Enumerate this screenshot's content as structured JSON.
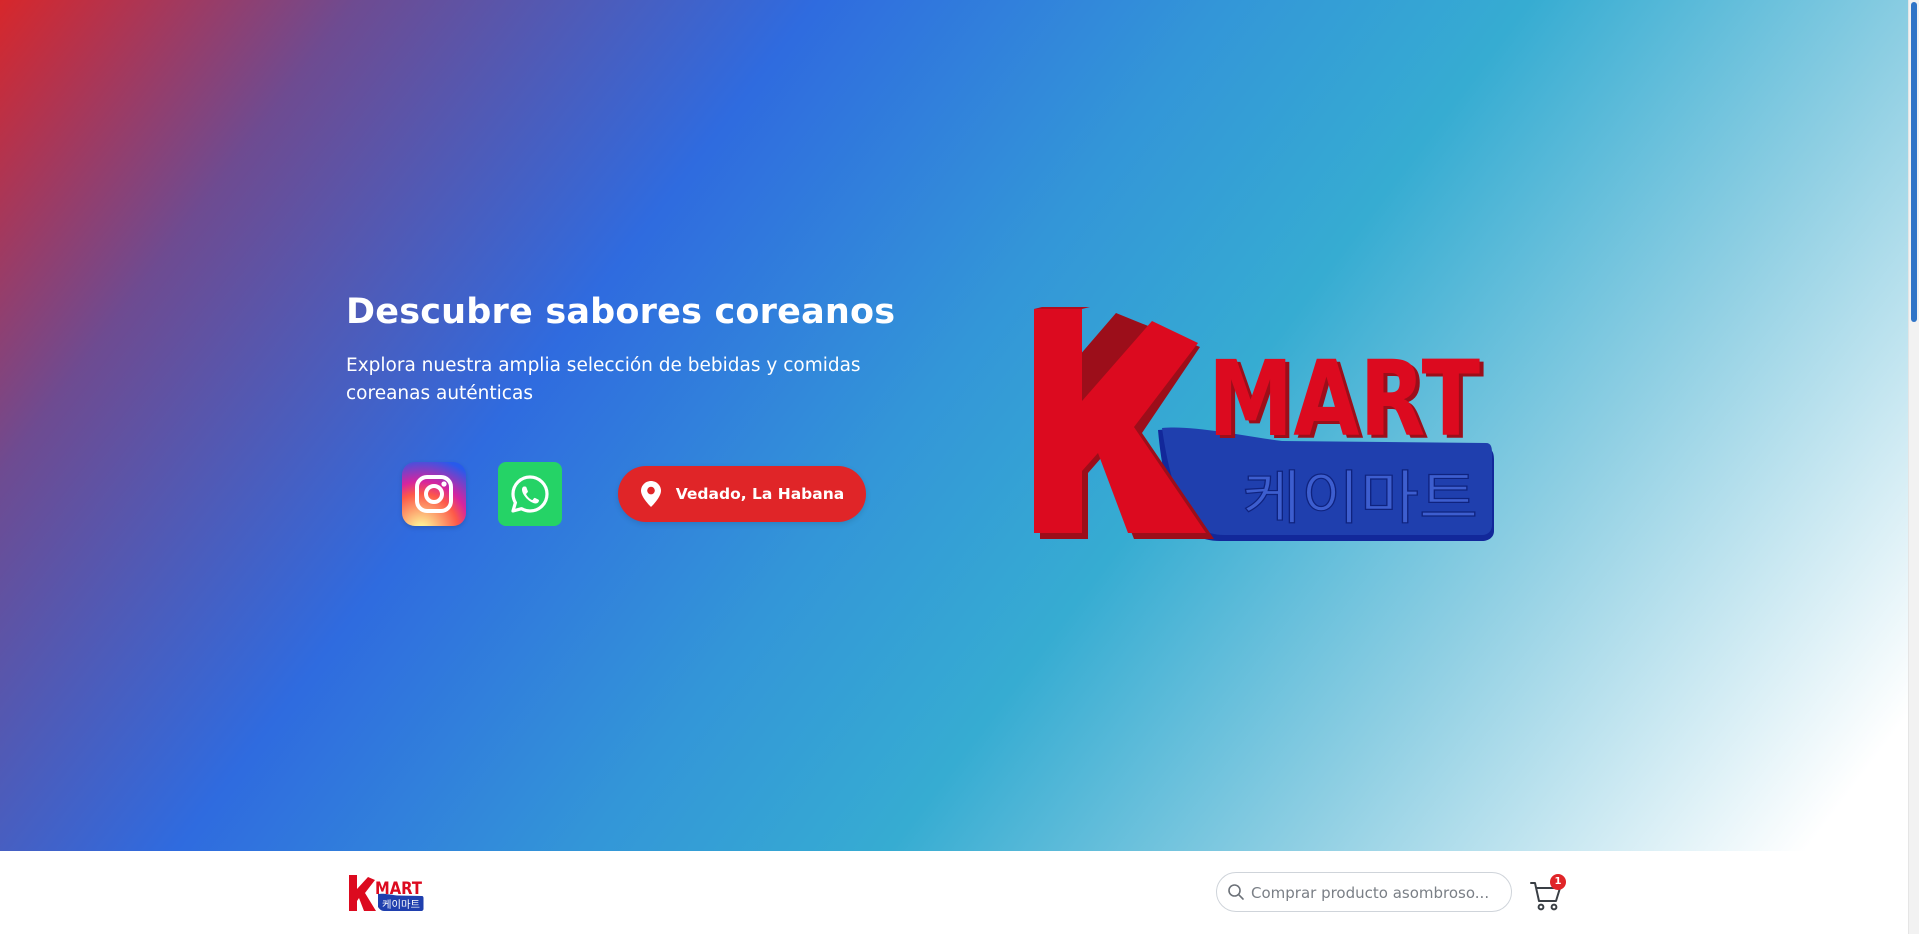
{
  "hero": {
    "title": "Descubre sabores coreanos",
    "subtitle": "Explora nuestra amplia selección de bebidas y comidas coreanas auténticas",
    "location_label": "Vedado, La Habana",
    "logo": {
      "main_text": "MART",
      "letter": "K",
      "korean_text": "케이마트"
    }
  },
  "social": [
    {
      "name": "Instagram",
      "icon": "instagram-icon"
    },
    {
      "name": "WhatsApp",
      "icon": "whatsapp-icon"
    }
  ],
  "navbar": {
    "search_placeholder": "Comprar producto asombroso...",
    "cart_count": "1"
  },
  "colors": {
    "brand_red": "#e02528",
    "brand_blue": "#1f3fae",
    "whatsapp_green": "#25d366"
  }
}
